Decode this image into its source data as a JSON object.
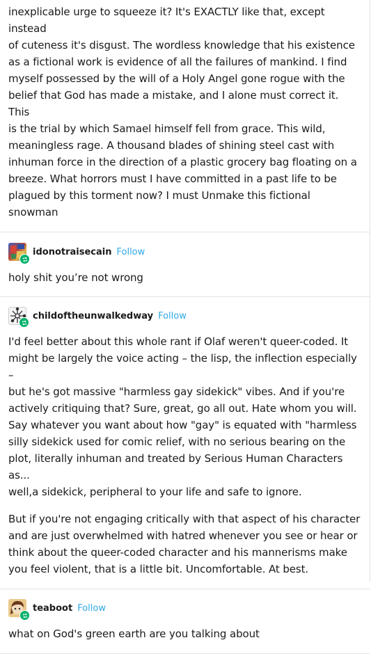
{
  "post0": {
    "lines": [
      "inexplicable urge to squeeze it? It's EXACTLY like that, except instead",
      "of cuteness it's disgust. The wordless knowledge that his existence",
      "as a fictional work is evidence of all the failures of mankind. I find",
      "myself possessed by the will of a Holy Angel gone rogue with the",
      "belief that God has made a mistake, and I alone must correct it. This",
      "is the trial by which Samael himself fell from grace. This wild,",
      "meaningless rage. A thousand blades of shining steel cast with",
      "inhuman force in the direction of a plastic grocery bag floating on a",
      "breeze. What horrors must I have committed in a past life to be",
      "plagued by this torment now? I must Unmake this fictional snowman"
    ]
  },
  "reblogs": [
    {
      "username": "idonotraisecain",
      "follow_label": "Follow",
      "paragraphs": [
        [
          "holy shit you’re not wrong"
        ]
      ]
    },
    {
      "username": "childoftheunwalkedway",
      "follow_label": "Follow",
      "paragraphs": [
        [
          "I'd feel better about this whole rant if Olaf weren't queer-coded. It",
          "might be largely the voice acting – the lisp, the inflection especially –",
          "but he's got massive \"harmless gay sidekick\" vibes. And if you're",
          "actively critiquing that? Sure, great, go all out. Hate whom you will.",
          "Say whatever you want about how \"gay\" is equated with \"harmless",
          "silly sidekick used for comic relief, with no serious bearing on the",
          "plot, literally inhuman and treated by Serious Human Characters as...",
          "well,a sidekick, peripheral to your life and safe to ignore."
        ],
        [
          "But if you're not engaging critically with that aspect of his character",
          "and are just overwhelmed with hatred whenever you see or hear or",
          "think about the queer-coded character and his mannerisms make",
          "you feel violent, that is a little bit. Uncomfortable. At best."
        ]
      ]
    },
    {
      "username": "teaboot",
      "follow_label": "Follow",
      "paragraphs": [
        [
          "what on God's green earth are you talking about"
        ]
      ]
    }
  ],
  "colors": {
    "follow": "#2ea8e6",
    "reblog_badge": "#00b06a",
    "separator": "#e3e3e3"
  }
}
